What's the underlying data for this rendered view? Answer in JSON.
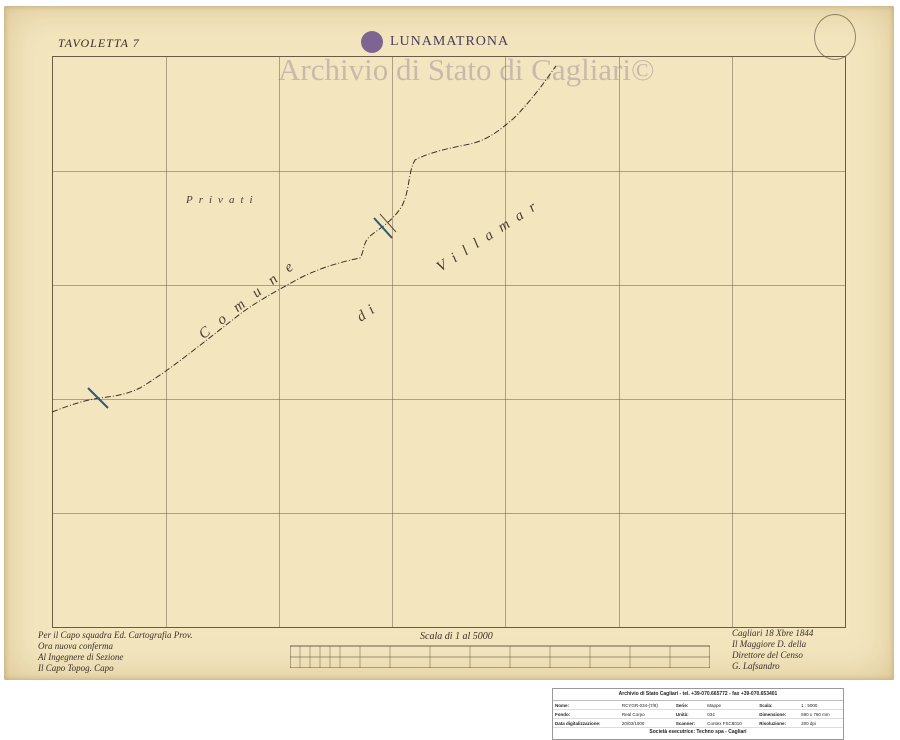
{
  "map": {
    "tavoletta": "TAVOLETTA 7",
    "town": "LUNAMATRONA",
    "watermark": "Archivio di Stato di Cagliari©",
    "labels": {
      "privati": "Privati",
      "comune": "Comune",
      "di": "di",
      "villamar": "Villamar"
    },
    "scale_title": "Scala di 1 al 5000",
    "signature_left": [
      "Per il Capo squadra Ed. Cartografia Prov.",
      "Ora nuova conferma",
      "Al Ingegnere di Sezione",
      "Il Capo Topog. Capo"
    ],
    "signature_right": [
      "Cagliari 18 Xbre 1844",
      "Il Maggiore D. della",
      "Direttore del Censo",
      "G. Lafsandro"
    ]
  },
  "footer": {
    "header": "Archivio di Stato Cagliari - tel. +39-070.665772 - fax +39-070.653401",
    "rows": [
      {
        "c1": "Nome:",
        "v1": "RCYGR-034-(7/8)",
        "c2": "Serie:",
        "v2": "Mappe",
        "c3": "Scala:",
        "v3": "1 : 5000"
      },
      {
        "c1": "Fondo:",
        "v1": "Real Corpo",
        "c2": "Unità:",
        "v2": "034",
        "c3": "Dimensione:",
        "v3": "590 x 760 mm"
      },
      {
        "c1": "Data digitalizzazione:",
        "v1": "20/03/1000",
        "c2": "Scanner:",
        "v2": "Contex FSC8010",
        "c3": "Risoluzione:",
        "v3": "200 dpi"
      }
    ],
    "footer_line": "Società esecutrice: Techno spa - Cagliari"
  }
}
